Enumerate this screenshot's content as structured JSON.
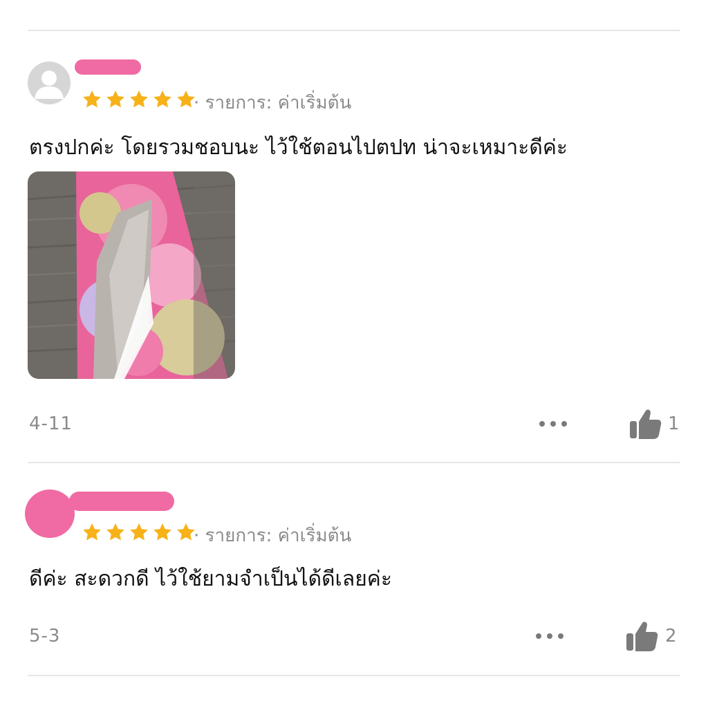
{
  "reviews": [
    {
      "rating": 5,
      "variation_text": "· รายการ: ค่าเริ่มต้น",
      "comment": "ตรงปกค่ะ โดยรวมชอบนะ ไว้ใช้ตอนไปตปท น่าจะเหมาะดีค่ะ",
      "date": "4-11",
      "like_count": "1",
      "has_photo": true
    },
    {
      "rating": 5,
      "variation_text": "· รายการ: ค่าเริ่มต้น",
      "comment": "ดีค่ะ สะดวกดี ไว้ใช้ยามจำเป็นได้ดีเลยค่ะ",
      "date": "5-3",
      "like_count": "2",
      "has_photo": false
    }
  ],
  "icons": {
    "star": "star-icon",
    "more": "more-dots-icon",
    "like": "thumbs-up-icon",
    "avatar": "user-avatar-icon"
  },
  "colors": {
    "star": "#F7B21A",
    "muted_text": "#8A8A8A",
    "divider": "#E6E6E6",
    "icon": "#7A7A7A",
    "redaction_pink": "#F06BA3"
  }
}
